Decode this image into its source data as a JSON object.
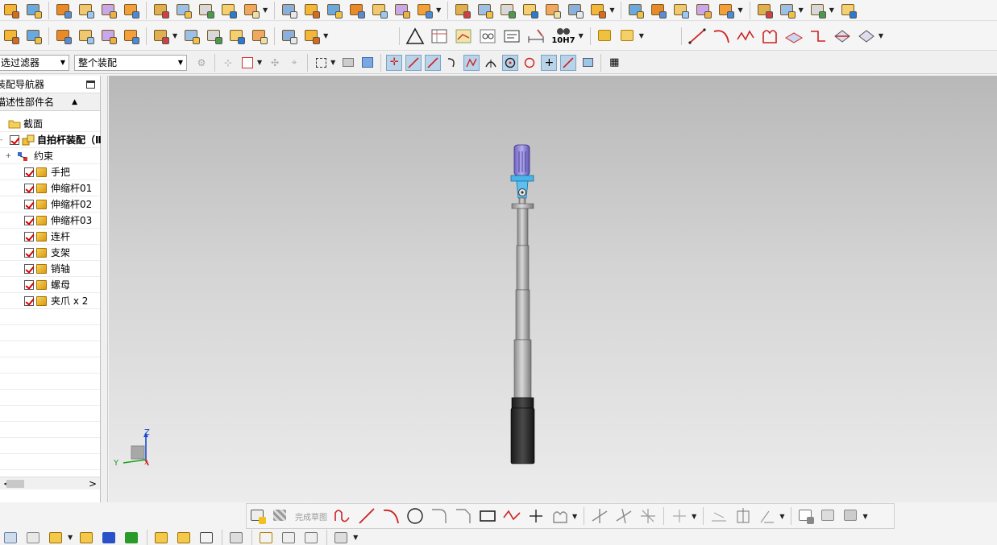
{
  "toolbar": {
    "row1_icons": [
      "part-icon",
      "block-icon",
      "cube-icon",
      "extrude-icon",
      "revolve-icon",
      "boss-icon",
      "hole-icon",
      "pattern-icon",
      "feature-pattern-icon",
      "merge-icon",
      "shell-icon",
      "draft-icon",
      "blend-icon",
      "chamfer-icon",
      "trim-body-icon",
      "split-body-icon",
      "offset-face-icon",
      "move-face-icon",
      "replace-face-icon",
      "sew-icon",
      "patch-icon",
      "emboss-icon",
      "thicken-icon",
      "surface-icon",
      "swept-icon",
      "through-curves-icon",
      "ruled-icon",
      "studio-surface-icon",
      "n-sided-icon",
      "extension-icon",
      "transform-icon",
      "assembly-add-icon",
      "assembly-move-icon",
      "assembly-constraint-icon"
    ],
    "row2_icons": [
      "layer-icon",
      "layer-settings-icon",
      "measure-icon",
      "wcs-icon",
      "move-object-icon",
      "component-icon",
      "text-icon",
      "analysis-icon",
      "section-icon",
      "spring-icon",
      "bearing-icon",
      "gear-icon",
      "feature-tools-icon"
    ],
    "row2_right_icons": [
      "triangle-icon",
      "table-icon",
      "grid-icon",
      "symbols-icon",
      "note-icon",
      "dimension-icon",
      "tolerance-icon",
      "assembly-icon",
      "assembly-list-icon",
      "line-icon",
      "arc-icon",
      "spline-icon",
      "profile-icon",
      "offset-curve-icon",
      "project-curve-icon",
      "intersection-curve-icon",
      "bridge-curve-icon"
    ],
    "tolerance_label": "10H7",
    "filter_select": "选过滤器",
    "assembly_select": "整个装配"
  },
  "navigator": {
    "title": "装配导航器",
    "column_header": "描述性部件名",
    "sort_glyph": "▲",
    "section_item": "截面",
    "root_assembly": "自拍杆装配（Ⅱ",
    "constraints": "约束",
    "parts": [
      "手把",
      "伸缩杆01",
      "伸缩杆02",
      "伸缩杆03",
      "连杆",
      "支架",
      "销轴",
      "螺母",
      "夹爪 x 2"
    ],
    "scroll_left": "<",
    "scroll_right": ">"
  },
  "viewport": {
    "axes": {
      "z": "Z",
      "y": "Y",
      "x": "X"
    }
  },
  "sketch_toolbar": {
    "finish_label": "完成草图"
  },
  "colors": {
    "viewport_top": "#b8b8b8",
    "viewport_bottom": "#ececec",
    "handle_grip": "#2a2a2a",
    "bracket_blue": "#4ab4e8",
    "clamp_purple": "#8a7fd8",
    "pole_gray": "#b5b5b5"
  }
}
